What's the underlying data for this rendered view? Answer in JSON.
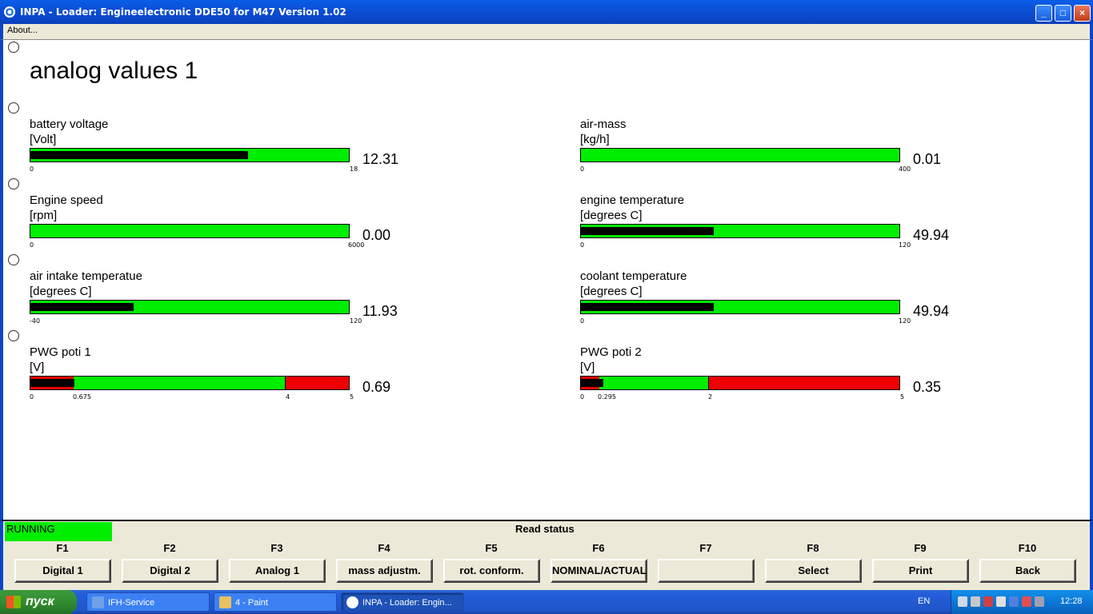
{
  "window": {
    "title": "INPA - Loader:  Engineelectronic DDE50 for M47 Version 1.02",
    "min": "_",
    "max": "□",
    "close": "×"
  },
  "menu": {
    "about": "About..."
  },
  "page": {
    "title": "analog values 1"
  },
  "gauges": [
    {
      "label": "battery voltage",
      "unit": "[Volt]",
      "value": "12.31",
      "fill_fraction": 0.684,
      "ticks": [
        "0",
        "18"
      ]
    },
    {
      "label": "air-mass",
      "unit": "[kg/h]",
      "value": "0.01",
      "fill_fraction": 0.0,
      "ticks": [
        "0",
        "400"
      ]
    },
    {
      "label": "Engine speed",
      "unit": "[rpm]",
      "value": "0.00",
      "fill_fraction": 0.0,
      "ticks": [
        "0",
        "6000"
      ]
    },
    {
      "label": "engine temperature",
      "unit": "[degrees C]",
      "value": "49.94",
      "fill_fraction": 0.416,
      "ticks": [
        "0",
        "120"
      ]
    },
    {
      "label": "air intake temperatue",
      "unit": "[degrees C]",
      "value": "11.93",
      "fill_fraction": 0.323,
      "ticks": [
        "-40",
        "120"
      ]
    },
    {
      "label": "coolant temperature",
      "unit": "[degrees C]",
      "value": "49.94",
      "fill_fraction": 0.416,
      "ticks": [
        "0",
        "120"
      ]
    },
    {
      "label": "PWG poti 1",
      "unit": "[V]",
      "value": "0.69",
      "fill_fraction": 0.138,
      "ticks": [
        "0",
        "0.675",
        "4",
        "5"
      ],
      "red_low_fraction": 0.135,
      "red_high_fraction": 0.2
    },
    {
      "label": "PWG poti 2",
      "unit": "[V]",
      "value": "0.35",
      "fill_fraction": 0.07,
      "ticks": [
        "0",
        "0.295",
        "2",
        "5"
      ],
      "red_low_fraction": 0.059,
      "red_high_fraction": 0.6
    }
  ],
  "status": {
    "running": "RUNNING",
    "read_status": "Read status"
  },
  "fkeys": [
    {
      "key": "F1",
      "label": "Digital 1"
    },
    {
      "key": "F2",
      "label": "Digital 2"
    },
    {
      "key": "F3",
      "label": "Analog 1"
    },
    {
      "key": "F4",
      "label": "mass adjustm."
    },
    {
      "key": "F5",
      "label": "rot. conform."
    },
    {
      "key": "F6",
      "label": "NOMINAL/ACTUAL"
    },
    {
      "key": "F7",
      "label": ""
    },
    {
      "key": "F8",
      "label": "Select"
    },
    {
      "key": "F9",
      "label": "Print"
    },
    {
      "key": "F10",
      "label": "Back"
    }
  ],
  "taskbar": {
    "start": "пуск",
    "tasks": [
      "IFH-Service",
      "4 - Paint",
      "INPA - Loader:  Engin..."
    ],
    "lang": "EN",
    "clock": "12:28"
  },
  "colors": {
    "bar_green": "#00ee00",
    "bar_red": "#ee0000",
    "bar_fill": "#000000",
    "title_blue": "#0a46c8"
  }
}
